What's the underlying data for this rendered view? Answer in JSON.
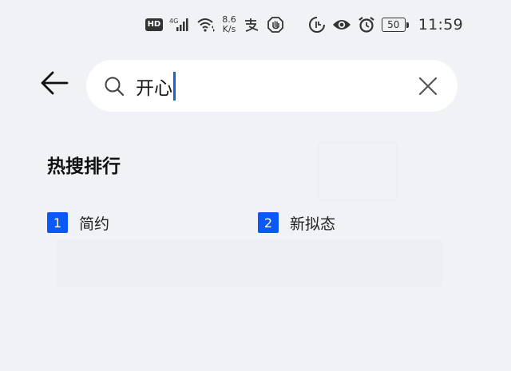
{
  "status_bar": {
    "hd_badge": "HD",
    "network_type": "4G",
    "net_speed_value": "8.6",
    "net_speed_unit": "K/s",
    "battery_level": "50",
    "time": "11:59"
  },
  "search": {
    "query": "开心"
  },
  "hot_search": {
    "title": "热搜排行",
    "items": [
      {
        "rank": "1",
        "label": "简约"
      },
      {
        "rank": "2",
        "label": "新拟态"
      }
    ]
  },
  "colors": {
    "background": "#f1f2f5",
    "accent": "#0a59f7",
    "caret": "#1a5fd9"
  }
}
